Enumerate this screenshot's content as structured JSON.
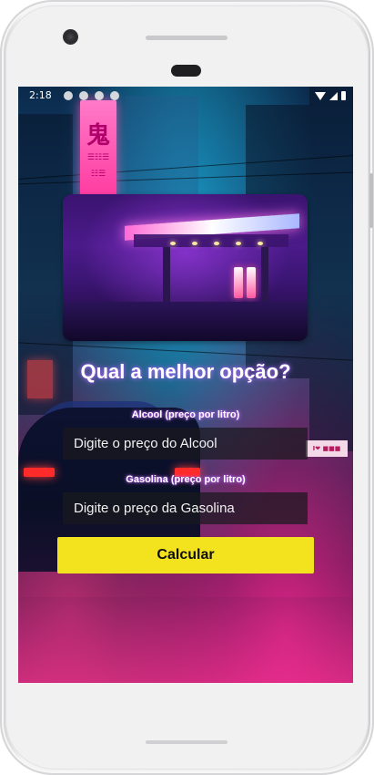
{
  "status_bar": {
    "time": "2:18"
  },
  "sign": {
    "text_top": "鬼",
    "text_mid": "☰☷☰",
    "text_bottom": "☷☰"
  },
  "street_sign": {
    "text": "I❤ ■■■"
  },
  "page": {
    "title": "Qual a melhor opção?",
    "alcool_label": "Alcool (preço por litro)",
    "alcool_placeholder": "Digite o preço do Alcool",
    "alcool_value": "",
    "gasolina_label": "Gasolina (preço por litro)",
    "gasolina_placeholder": "Digite o preço da Gasolina",
    "gasolina_value": "",
    "calculate_label": "Calcular"
  },
  "colors": {
    "button_bg": "#f3e21e",
    "title_glow": "#b478ff",
    "field_bg": "#19191e"
  }
}
